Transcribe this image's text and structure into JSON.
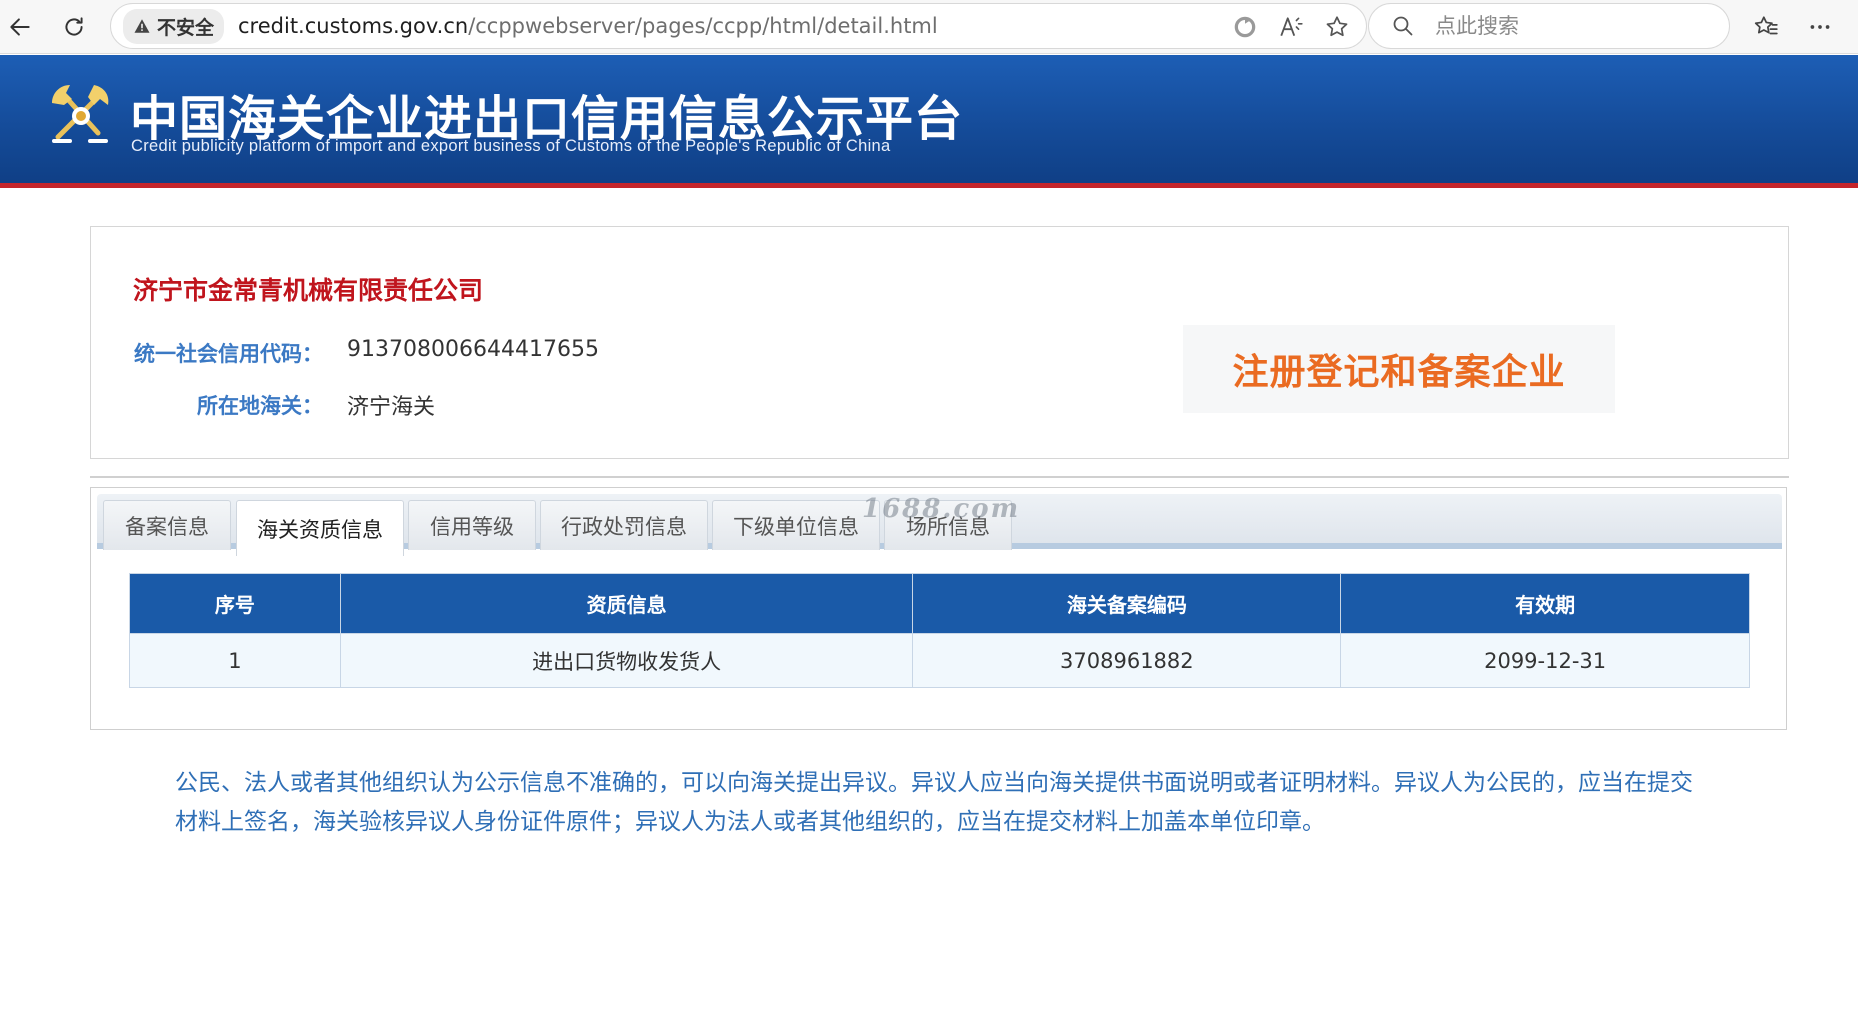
{
  "browser": {
    "insecure_label": "不安全",
    "url_host": "credit.customs.gov.cn",
    "url_path": "/ccppwebserver/pages/ccpp/html/detail.html",
    "search_placeholder": "点此搜索"
  },
  "header": {
    "title": "中国海关企业进出口信用信息公示平台",
    "subtitle": "Credit publicity platform of import and export business of Customs of the People's Republic of China",
    "colors": {
      "banner": "#1a56a8",
      "accent_red": "#c4252b"
    }
  },
  "company": {
    "name": "济宁市金常青机械有限责任公司",
    "credit_code_label": "统一社会信用代码：",
    "credit_code": "913708006644417655",
    "customs_label": "所在地海关：",
    "customs": "济宁海关",
    "status_stamp": "注册登记和备案企业"
  },
  "tabs": [
    {
      "label": "备案信息",
      "active": false
    },
    {
      "label": "海关资质信息",
      "active": true
    },
    {
      "label": "信用等级",
      "active": false
    },
    {
      "label": "行政处罚信息",
      "active": false
    },
    {
      "label": "下级单位信息",
      "active": false
    },
    {
      "label": "场所信息",
      "active": false
    }
  ],
  "watermark": "1688.com",
  "table": {
    "headers": [
      "序号",
      "资质信息",
      "海关备案编码",
      "有效期"
    ],
    "rows": [
      [
        "1",
        "进出口货物收发货人",
        "3708961882",
        "2099-12-31"
      ]
    ]
  },
  "notice": "公民、法人或者其他组织认为公示信息不准确的，可以向海关提出异议。异议人应当向海关提供书面说明或者证明材料。异议人为公民的，应当在提交材料上签名，海关验核异议人身份证件原件；异议人为法人或者其他组织的，应当在提交材料上加盖本单位印章。"
}
